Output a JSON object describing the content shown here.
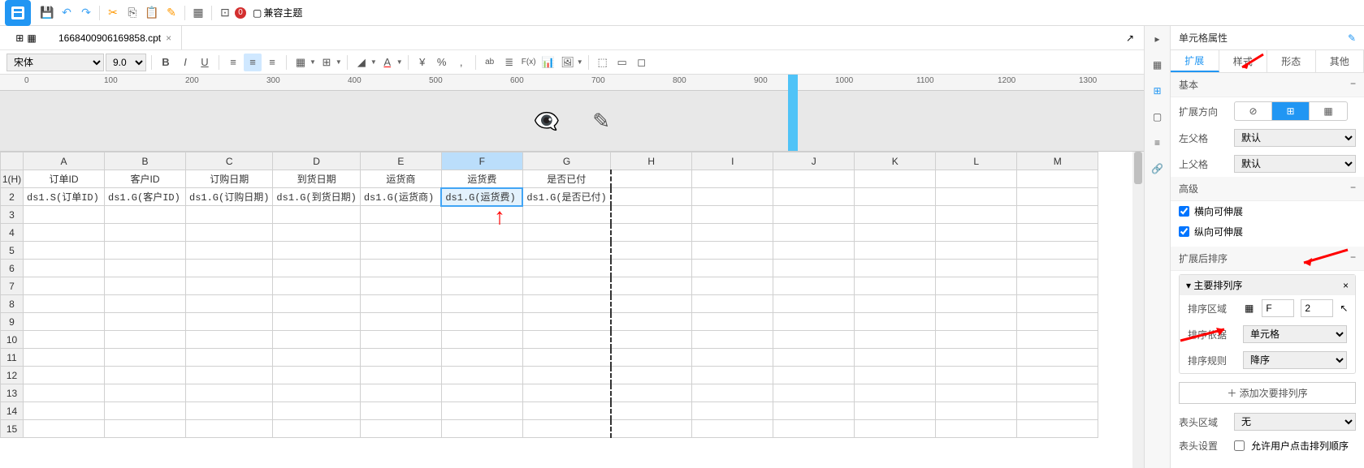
{
  "toolbar": {
    "compat_label": "兼容主题",
    "alert_count": "0"
  },
  "file_tab": {
    "label": "1668400906169858.cpt"
  },
  "format": {
    "font": "宋体",
    "size": "9.0"
  },
  "ruler_ticks": [
    "0",
    "100",
    "200",
    "300",
    "400",
    "500",
    "600",
    "700",
    "800",
    "900",
    "1000",
    "1100",
    "1200",
    "1300"
  ],
  "columns": [
    "A",
    "B",
    "C",
    "D",
    "E",
    "F",
    "G",
    "H",
    "I",
    "J",
    "K",
    "L",
    "M"
  ],
  "row1label": "1(H)",
  "headers": [
    "订单ID",
    "客户ID",
    "订购日期",
    "到货日期",
    "运货商",
    "运货费",
    "是否已付"
  ],
  "row2": [
    "ds1.S(订单ID)",
    "ds1.G(客户ID)",
    "ds1.G(订购日期)",
    "ds1.G(到货日期)",
    "ds1.G(运货商)",
    "ds1.G(运货费)",
    "ds1.G(是否已付)"
  ],
  "right": {
    "title": "单元格属性",
    "tabs": [
      "扩展",
      "样式",
      "形态",
      "其他"
    ],
    "basic": "基本",
    "expand_dir": "扩展方向",
    "left_parent": "左父格",
    "left_parent_val": "默认",
    "top_parent": "上父格",
    "top_parent_val": "默认",
    "advanced": "高级",
    "h_expand": "横向可伸展",
    "v_expand": "纵向可伸展",
    "sort_after": "扩展后排序",
    "main_sort": "主要排列序",
    "sort_range": "排序区域",
    "sort_col": "F",
    "sort_row": "2",
    "sort_basis": "排序依据",
    "sort_basis_val": "单元格",
    "sort_rule": "排序规则",
    "sort_rule_val": "降序",
    "add_sort": "添加次要排列序",
    "header_area": "表头区域",
    "header_area_val": "无",
    "header_set": "表头设置",
    "allow_click": "允许用户点击排列顺序"
  }
}
